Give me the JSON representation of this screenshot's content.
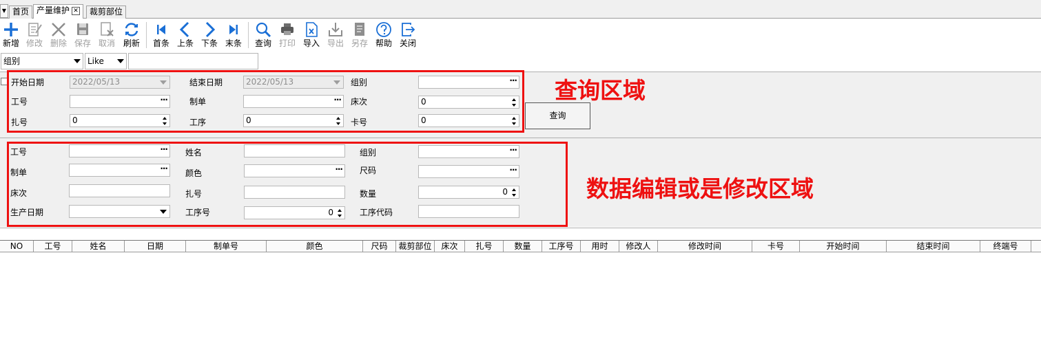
{
  "tabs": [
    {
      "label": "首页",
      "active": false
    },
    {
      "label": "产量维护",
      "active": true
    },
    {
      "label": "裁剪部位",
      "active": false
    }
  ],
  "toolbar": [
    {
      "label": "新增",
      "icon": "plus-icon",
      "disabled": false
    },
    {
      "label": "修改",
      "icon": "edit-icon",
      "disabled": true
    },
    {
      "label": "删除",
      "icon": "delete-icon",
      "disabled": true
    },
    {
      "label": "保存",
      "icon": "save-icon",
      "disabled": true
    },
    {
      "label": "取消",
      "icon": "cancel-icon",
      "disabled": true
    },
    {
      "label": "刷新",
      "icon": "refresh-icon",
      "disabled": false
    },
    {
      "label": "首条",
      "icon": "first-record-icon",
      "disabled": false
    },
    {
      "label": "上条",
      "icon": "previous-record-icon",
      "disabled": false
    },
    {
      "label": "下条",
      "icon": "next-record-icon",
      "disabled": false
    },
    {
      "label": "末条",
      "icon": "last-record-icon",
      "disabled": false
    },
    {
      "label": "查询",
      "icon": "search-icon",
      "disabled": false
    },
    {
      "label": "打印",
      "icon": "print-icon",
      "disabled": true
    },
    {
      "label": "导入",
      "icon": "import-icon",
      "disabled": false
    },
    {
      "label": "导出",
      "icon": "export-icon",
      "disabled": true
    },
    {
      "label": "另存",
      "icon": "save-as-icon",
      "disabled": true
    },
    {
      "label": "帮助",
      "icon": "help-icon",
      "disabled": false
    },
    {
      "label": "关闭",
      "icon": "close-icon",
      "disabled": false
    }
  ],
  "filter": {
    "field": "组别",
    "operator": "Like",
    "value": ""
  },
  "query": {
    "start_date_label": "开始日期",
    "start_date_value": "2022/05/13",
    "end_date_label": "结束日期",
    "end_date_value": "2022/05/13",
    "group_label": "组别",
    "group_value": "",
    "worker_label": "工号",
    "worker_value": "",
    "order_label": "制单",
    "order_value": "",
    "bed_label": "床次",
    "bed_value": "0",
    "bundle_label": "扎号",
    "bundle_value": "0",
    "process_label": "工序",
    "process_value": "0",
    "card_label": "卡号",
    "card_value": "0",
    "button_label": "查询",
    "annotation": "查询区域"
  },
  "edit": {
    "worker_label": "工号",
    "worker_value": "",
    "name_label": "姓名",
    "name_value": "",
    "group_label": "组别",
    "group_value": "",
    "order_label": "制单",
    "order_value": "",
    "color_label": "颜色",
    "color_value": "",
    "size_label": "尺码",
    "size_value": "",
    "bed_label": "床次",
    "bed_value": "",
    "bundle_label": "扎号",
    "bundle_value": "",
    "qty_label": "数量",
    "qty_value": "0",
    "date_label": "生产日期",
    "date_value": "",
    "proc_no_label": "工序号",
    "proc_no_value": "0",
    "proc_code_label": "工序代码",
    "proc_code_value": "",
    "annotation": "数据编辑或是修改区域"
  },
  "grid": {
    "columns": [
      "NO",
      "工号",
      "姓名",
      "日期",
      "制单号",
      "颜色",
      "尺码",
      "裁剪部位",
      "床次",
      "扎号",
      "数量",
      "工序号",
      "用时",
      "修改人",
      "修改时间",
      "卡号",
      "开始时间",
      "结束时间",
      "终端号"
    ]
  },
  "colors": {
    "annotation_red": "#ee1111",
    "toolbar_blue": "#1a6fd6",
    "panel_bg": "#f0f0f0"
  }
}
